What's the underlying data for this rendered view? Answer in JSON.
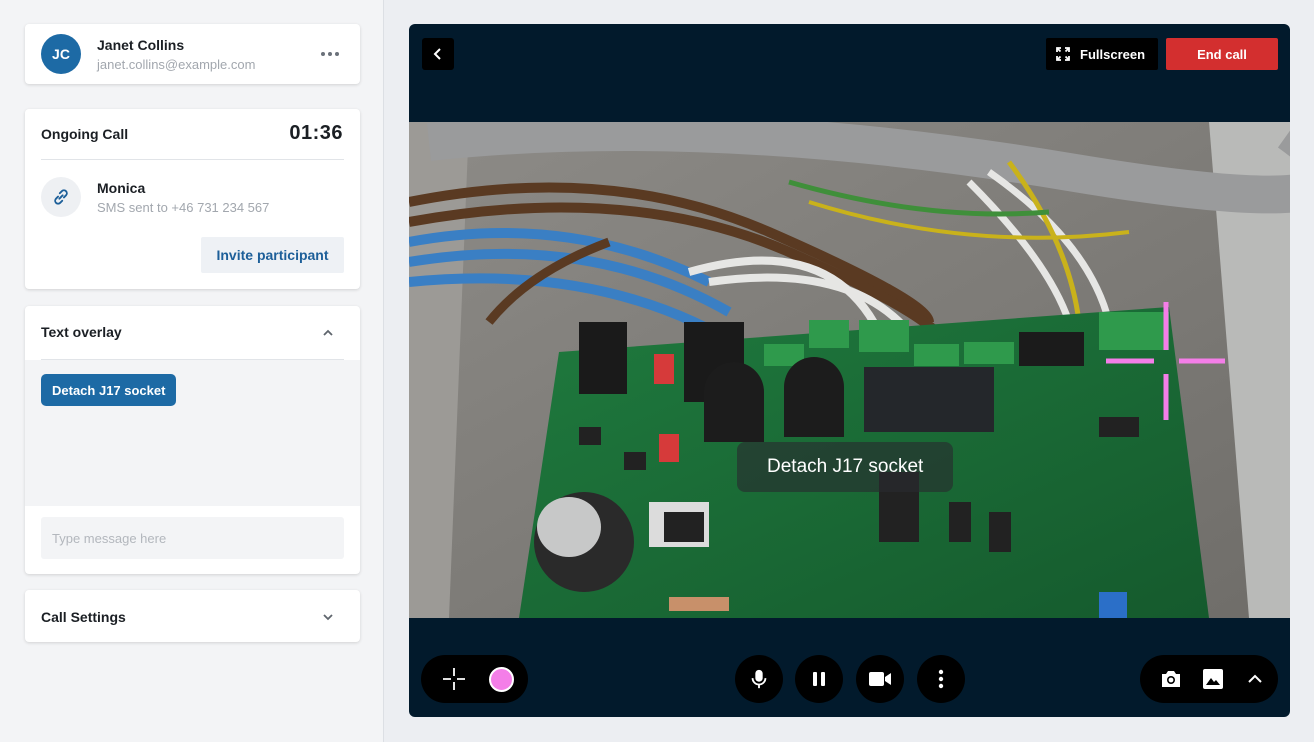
{
  "user": {
    "initials": "JC",
    "name": "Janet Collins",
    "email": "janet.collins@example.com"
  },
  "call": {
    "title": "Ongoing Call",
    "timer": "01:36",
    "participant": {
      "name": "Monica",
      "status": "SMS sent to +46 731 234 567"
    },
    "invite_label": "Invite participant"
  },
  "text_overlay": {
    "title": "Text overlay",
    "expanded": true,
    "chip_label": "Detach J17 socket",
    "input_placeholder": "Type message here"
  },
  "call_settings": {
    "title": "Call Settings",
    "expanded": false
  },
  "video": {
    "fullscreen_label": "Fullscreen",
    "end_call_label": "End call",
    "overlay_caption": "Detach J17 socket",
    "pointer_color": "#f47ee8"
  },
  "colors": {
    "accent": "#1d6aa5",
    "end_call": "#d32f2f",
    "panel_bg": "#021a2c"
  },
  "icons": {
    "back": "chevron-left-icon",
    "fullscreen": "fullscreen-icon",
    "crosshair": "crosshair-icon",
    "microphone": "microphone-icon",
    "pause": "pause-icon",
    "camera": "video-camera-icon",
    "more": "more-vertical-icon",
    "snapshot": "photo-camera-icon",
    "image": "image-icon",
    "expand": "chevron-up-icon"
  }
}
